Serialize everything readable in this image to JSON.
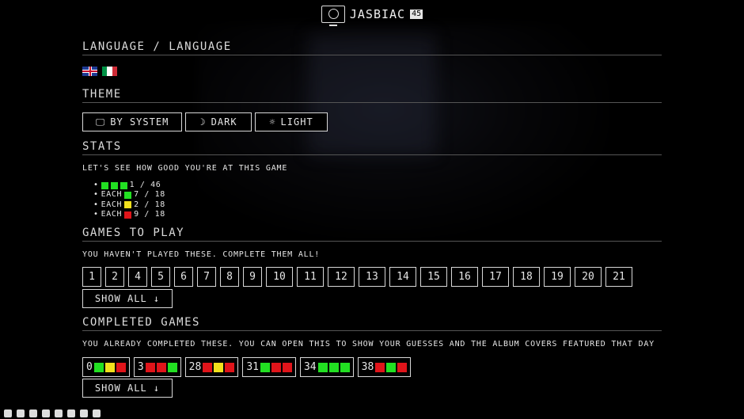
{
  "header": {
    "brand": "JASBIAC",
    "version": "45"
  },
  "language": {
    "title": "LANGUAGE / LANGUAGE",
    "flags": [
      "uk-flag",
      "italy-flag"
    ]
  },
  "theme": {
    "title": "THEME",
    "buttons": [
      {
        "label": "BY SYSTEM",
        "icon": "monitor-icon",
        "glyph": "🖵"
      },
      {
        "label": "DARK",
        "icon": "moon-icon",
        "glyph": "☽"
      },
      {
        "label": "LIGHT",
        "icon": "sun-icon",
        "glyph": "☼"
      }
    ]
  },
  "stats": {
    "title": "STATS",
    "subtitle": "LET'S SEE HOW GOOD YOU'RE AT THIS GAME",
    "rows": [
      {
        "prefix": "",
        "colors": [
          "g",
          "g",
          "g"
        ],
        "value": "1 / 46"
      },
      {
        "prefix": "EACH",
        "colors": [
          "g"
        ],
        "value": "7 / 18"
      },
      {
        "prefix": "EACH",
        "colors": [
          "y"
        ],
        "value": "2 / 18"
      },
      {
        "prefix": "EACH",
        "colors": [
          "rd"
        ],
        "value": "9 / 18"
      }
    ]
  },
  "games_to_play": {
    "title": "GAMES TO PLAY",
    "subtitle": "YOU HAVEN'T PLAYED THESE. COMPLETE THEM ALL!",
    "items": [
      "1",
      "2",
      "4",
      "5",
      "6",
      "7",
      "8",
      "9",
      "10",
      "11",
      "12",
      "13",
      "14",
      "15",
      "16",
      "17",
      "18",
      "19",
      "20",
      "21"
    ],
    "show_all": "SHOW ALL ↓"
  },
  "completed": {
    "title": "COMPLETED GAMES",
    "subtitle": "YOU ALREADY COMPLETED THESE. YOU CAN OPEN THIS TO SHOW YOUR GUESSES AND THE ALBUM COVERS FEATURED THAT DAY",
    "items": [
      {
        "num": "0",
        "colors": [
          "g",
          "y",
          "rd"
        ]
      },
      {
        "num": "3",
        "colors": [
          "rd",
          "rd",
          "g"
        ]
      },
      {
        "num": "28",
        "colors": [
          "rd",
          "y",
          "rd"
        ]
      },
      {
        "num": "31",
        "colors": [
          "g",
          "rd",
          "rd"
        ]
      },
      {
        "num": "34",
        "colors": [
          "g",
          "g",
          "g"
        ]
      },
      {
        "num": "38",
        "colors": [
          "rd",
          "g",
          "rd"
        ]
      }
    ],
    "show_all": "SHOW ALL ↓"
  },
  "colors": {
    "green": "#22e022",
    "yellow": "#f2e01c",
    "red": "#e0141a"
  },
  "footer_icons": [
    "facebook-icon",
    "x-icon",
    "bluesky-icon",
    "youtube-icon",
    "messenger-icon",
    "instagram-icon",
    "telegram-icon",
    "soundcloud-icon"
  ]
}
